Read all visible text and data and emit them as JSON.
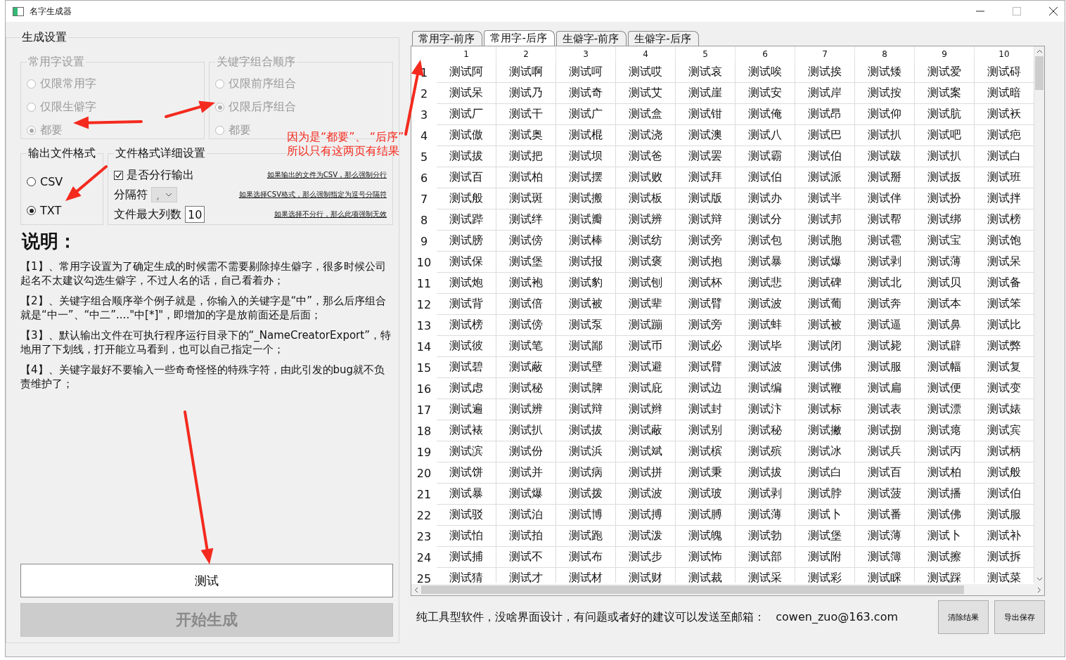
{
  "window": {
    "title": "名字生成器"
  },
  "settings": {
    "title": "生成设置",
    "common_chars": {
      "title": "常用字设置",
      "disabled": true,
      "options": [
        {
          "label": "仅限常用字",
          "selected": false
        },
        {
          "label": "仅限生僻字",
          "selected": false
        },
        {
          "label": "都要",
          "selected": true
        }
      ]
    },
    "keyword_order": {
      "title": "关键字组合顺序",
      "disabled": true,
      "options": [
        {
          "label": "仅限前序组合",
          "selected": false
        },
        {
          "label": "仅限后序组合",
          "selected": true
        },
        {
          "label": "都要",
          "selected": false
        }
      ]
    },
    "output_format": {
      "title": "输出文件格式",
      "disabled": false,
      "options": [
        {
          "label": "CSV",
          "selected": false
        },
        {
          "label": "TXT",
          "selected": true
        }
      ]
    },
    "file_details": {
      "title": "文件格式详细设置",
      "split_lines": {
        "label": "是否分行输出",
        "checked": true
      },
      "separator": {
        "label": "分隔符",
        "value": ",",
        "disabled": true
      },
      "max_columns": {
        "label": "文件最大列数",
        "value": "10"
      },
      "notes": [
        "如果输出的文件为CSV，那么强制分行",
        "如果选择CSV格式，那么强制指定为逗号分隔符",
        "如果选择不分行，那么此项强制无效"
      ]
    },
    "help": {
      "title": "说明：",
      "paragraphs": [
        "【1】、常用字设置为了确定生成的时候需不需要剔除掉生僻字，很多时候公司起名不太建议勾选生僻字，不过人名的话，自己看着办；",
        "【2】、关键字组合顺序举个例子就是，你输入的关键字是“中”，那么后序组合就是“中一”、“中二”....\"中[*]\"，即增加的字是放前面还是后面；",
        "【3】、默认输出文件在可执行程序运行目录下的“_NameCreatorExport”，特地用了下划线，打开能立马看到，也可以自己指定一个；",
        "【4】、关键字最好不要输入一些奇奇怪怪的特殊字符，由此引发的bug就不负责维护了；"
      ]
    },
    "buttons": [
      {
        "label": "测试",
        "disabled": false
      },
      {
        "label": "开始生成",
        "disabled": true
      }
    ]
  },
  "tabs": [
    {
      "label": "常用字-前序",
      "selected": false
    },
    {
      "label": "常用字-后序",
      "selected": true
    },
    {
      "label": "生僻字-前序",
      "selected": false
    },
    {
      "label": "生僻字-后序",
      "selected": false
    }
  ],
  "table": {
    "columns": [
      "1",
      "2",
      "3",
      "4",
      "5",
      "6",
      "7",
      "8",
      "9",
      "10"
    ],
    "rows": [
      {
        "header": "1",
        "cells": [
          "测试阿",
          "测试啊",
          "测试呵",
          "测试哎",
          "测试哀",
          "测试唉",
          "测试挨",
          "测试矮",
          "测试爱",
          "测试碍"
        ]
      },
      {
        "header": "2",
        "cells": [
          "测试呆",
          "测试乃",
          "测试奇",
          "测试艾",
          "测试崖",
          "测试安",
          "测试岸",
          "测试按",
          "测试案",
          "测试暗"
        ]
      },
      {
        "header": "3",
        "cells": [
          "测试厂",
          "测试干",
          "测试广",
          "测试盒",
          "测试钳",
          "测试俺",
          "测试昂",
          "测试仰",
          "测试肮",
          "测试袄"
        ]
      },
      {
        "header": "4",
        "cells": [
          "测试傲",
          "测试奥",
          "测试棍",
          "测试浇",
          "测试澳",
          "测试八",
          "测试巴",
          "测试扒",
          "测试吧",
          "测试疤"
        ]
      },
      {
        "header": "5",
        "cells": [
          "测试拔",
          "测试把",
          "测试坝",
          "测试爸",
          "测试罢",
          "测试霸",
          "测试伯",
          "测试跋",
          "测试扒",
          "测试白"
        ]
      },
      {
        "header": "6",
        "cells": [
          "测试百",
          "测试柏",
          "测试摆",
          "测试败",
          "测试拜",
          "测试伯",
          "测试派",
          "测试掰",
          "测试扳",
          "测试班"
        ]
      },
      {
        "header": "7",
        "cells": [
          "测试般",
          "测试斑",
          "测试搬",
          "测试板",
          "测试版",
          "测试办",
          "测试半",
          "测试伴",
          "测试扮",
          "测试拌"
        ]
      },
      {
        "header": "8",
        "cells": [
          "测试跸",
          "测试绊",
          "测试瓣",
          "测试辨",
          "测试辩",
          "测试分",
          "测试邦",
          "测试帮",
          "测试绑",
          "测试榜"
        ]
      },
      {
        "header": "9",
        "cells": [
          "测试膀",
          "测试傍",
          "测试棒",
          "测试纺",
          "测试旁",
          "测试包",
          "测试胞",
          "测试雹",
          "测试宝",
          "测试饱"
        ]
      },
      {
        "header": "10",
        "cells": [
          "测试保",
          "测试堡",
          "测试报",
          "测试褒",
          "测试抱",
          "测试暴",
          "测试爆",
          "测试剥",
          "测试薄",
          "测试呆"
        ]
      },
      {
        "header": "11",
        "cells": [
          "测试炮",
          "测试袍",
          "测试豹",
          "测试刨",
          "测试杯",
          "测试悲",
          "测试碑",
          "测试北",
          "测试贝",
          "测试备"
        ]
      },
      {
        "header": "12",
        "cells": [
          "测试背",
          "测试倍",
          "测试被",
          "测试辈",
          "测试臂",
          "测试波",
          "测试葡",
          "测试奔",
          "测试本",
          "测试笨"
        ]
      },
      {
        "header": "13",
        "cells": [
          "测试榜",
          "测试傍",
          "测试泵",
          "测试蹦",
          "测试旁",
          "测试蚌",
          "测试被",
          "测试逼",
          "测试鼻",
          "测试比"
        ]
      },
      {
        "header": "14",
        "cells": [
          "测试彼",
          "测试笔",
          "测试鄙",
          "测试币",
          "测试必",
          "测试毕",
          "测试闭",
          "测试毙",
          "测试辟",
          "测试弊"
        ]
      },
      {
        "header": "15",
        "cells": [
          "测试碧",
          "测试蔽",
          "测试壁",
          "测试避",
          "测试臂",
          "测试波",
          "测试佛",
          "测试服",
          "测试幅",
          "测试复"
        ]
      },
      {
        "header": "16",
        "cells": [
          "测试虑",
          "测试秘",
          "测试脾",
          "测试庇",
          "测试边",
          "测试编",
          "测试鞭",
          "测试扁",
          "测试便",
          "测试变"
        ]
      },
      {
        "header": "17",
        "cells": [
          "测试遍",
          "测试辨",
          "测试辩",
          "测试辫",
          "测试封",
          "测试汴",
          "测试标",
          "测试表",
          "测试漂",
          "测试婊"
        ]
      },
      {
        "header": "18",
        "cells": [
          "测试裱",
          "测试扒",
          "测试拔",
          "测试蔽",
          "测试别",
          "测试秘",
          "测试撇",
          "测试捌",
          "测试瘪",
          "测试宾"
        ]
      },
      {
        "header": "19",
        "cells": [
          "测试滨",
          "测试份",
          "测试浜",
          "测试斌",
          "测试槟",
          "测试殡",
          "测试冰",
          "测试兵",
          "测试丙",
          "测试柄"
        ]
      },
      {
        "header": "20",
        "cells": [
          "测试饼",
          "测试并",
          "测试病",
          "测试拼",
          "测试秉",
          "测试拔",
          "测试白",
          "测试百",
          "测试柏",
          "测试般"
        ]
      },
      {
        "header": "21",
        "cells": [
          "测试暴",
          "测试爆",
          "测试拨",
          "测试波",
          "测试玻",
          "测试剥",
          "测试脖",
          "测试菠",
          "测试播",
          "测试伯"
        ]
      },
      {
        "header": "22",
        "cells": [
          "测试驳",
          "测试泊",
          "测试博",
          "测试搏",
          "测试膊",
          "测试薄",
          "测试卜",
          "测试番",
          "测试佛",
          "测试服"
        ]
      },
      {
        "header": "23",
        "cells": [
          "测试怕",
          "测试拍",
          "测试跑",
          "测试泼",
          "测试魄",
          "测试勃",
          "测试堡",
          "测试薄",
          "测试卜",
          "测试补"
        ]
      },
      {
        "header": "24",
        "cells": [
          "测试捕",
          "测试不",
          "测试布",
          "测试步",
          "测试怖",
          "测试部",
          "测试附",
          "测试簿",
          "测试擦",
          "测试拆"
        ]
      },
      {
        "header": "25",
        "cells": [
          "测试猜",
          "测试才",
          "测试材",
          "测试财",
          "测试裁",
          "测试采",
          "测试彩",
          "测试睬",
          "测试踩",
          "测试菜"
        ]
      }
    ]
  },
  "footer": {
    "text": "纯工具型软件，没啥界面设计，有问题或者好的建议可以发送至邮箱：   cowen_zuo@163.com",
    "buttons": [
      "清除结果",
      "导出保存"
    ]
  },
  "annotation": {
    "lines": [
      "因为是“都要”、  “后序”",
      "所以只有这两页有结果"
    ]
  }
}
